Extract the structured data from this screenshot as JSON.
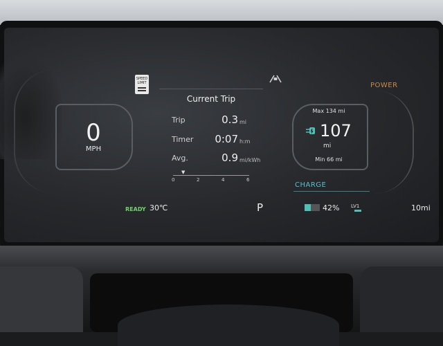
{
  "speed": {
    "value": "0",
    "unit": "MPH"
  },
  "speed_limit_sign": {
    "line1": "SPEED",
    "line2": "LIMIT"
  },
  "trip_panel": {
    "title": "Current Trip",
    "rows": [
      {
        "label": "Trip",
        "value": "0.3",
        "unit": "mi"
      },
      {
        "label": "Timer",
        "value": "0:07",
        "unit": "h:m"
      },
      {
        "label": "Avg.",
        "value": "0.9",
        "unit": "mi/kWh"
      }
    ],
    "scale_ticks": [
      "0",
      "2",
      "4",
      "6"
    ]
  },
  "range": {
    "max": "Max 134 mi",
    "value": "107",
    "unit": "mi",
    "min": "Min 66 mi"
  },
  "gauges": {
    "power_label": "POWER",
    "charge_label": "CHARGE"
  },
  "status_bar": {
    "ready": "READY",
    "temperature": "30℃",
    "gear": "P",
    "battery_percent": "42%",
    "battery_level": 0.42,
    "lv_label": "LV1",
    "odometer": "10mi"
  },
  "colors": {
    "ready": "#6fd36a",
    "charge": "#55c3cc",
    "power": "#c98a4e",
    "battery": "#4fc0b6"
  },
  "icons": [
    "speed-limit-sign-icon",
    "lane-assist-icon",
    "ev-plug-icon"
  ]
}
